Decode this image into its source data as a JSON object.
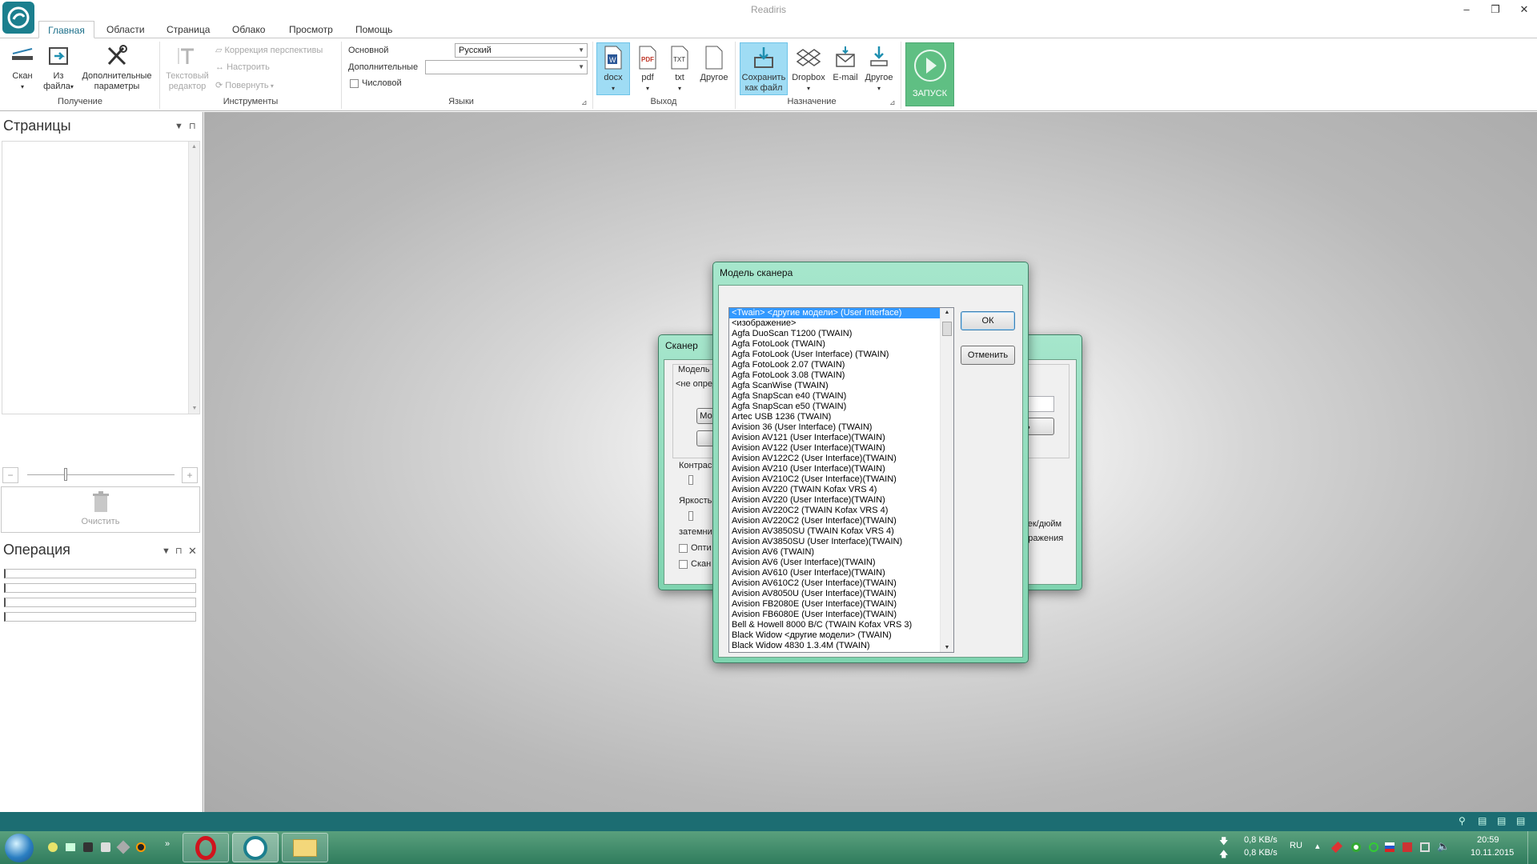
{
  "window": {
    "title": "Readiris",
    "minimize": "–",
    "restore": "❐",
    "close": "✕"
  },
  "tabs": [
    "Главная",
    "Области",
    "Страница",
    "Облако",
    "Просмотр",
    "Помощь"
  ],
  "ribbon": {
    "acquire": {
      "scan": "Скан",
      "from_file_1": "Из",
      "from_file_2": "файла",
      "advanced_1": "Дополнительные",
      "advanced_2": "параметры",
      "group": "Получение"
    },
    "tools": {
      "text_editor_1": "Текстовый",
      "text_editor_2": "редактор",
      "perspective": "Коррекция перспективы",
      "adjust": "Настроить",
      "rotate": "Повернуть",
      "group": "Инструменты"
    },
    "languages": {
      "main_label": "Основной",
      "main_value": "Русский",
      "extra_label": "Дополнительные",
      "extra_value": "",
      "numeric": "Числовой",
      "group": "Языки"
    },
    "output": {
      "docx": "docx",
      "pdf": "pdf",
      "txt": "txt",
      "other": "Другое",
      "group": "Выход"
    },
    "destination": {
      "save_1": "Сохранить",
      "save_2": "как файл",
      "dropbox": "Dropbox",
      "email": "E-mail",
      "other": "Другое",
      "group": "Назначение"
    },
    "launch": "ЗАПУСК"
  },
  "left": {
    "pages_title": "Страницы",
    "clear": "Очистить",
    "operations_title": "Операция"
  },
  "scanner_dialog": {
    "title": "Сканер",
    "model_label": "Модель с",
    "model_value": "<не опред",
    "model_btn": "Мо",
    "contrast": "Контрас",
    "brightness": "Яркость",
    "darken": "затемни",
    "opt1": "Опти",
    "opt2": "Скан",
    "right_btn": "ь",
    "resolution_tail": "а",
    "dpi_tail": "чек/дюйм",
    "image_tail": "бражения"
  },
  "model_dialog": {
    "title": "Модель сканера",
    "ok": "ОК",
    "cancel": "Отменить",
    "items": [
      "<Twain> <другие модели> (User Interface)",
      "<изображение>",
      "Agfa DuoScan T1200 (TWAIN)",
      "Agfa FotoLook (TWAIN)",
      "Agfa FotoLook (User Interface) (TWAIN)",
      "Agfa FotoLook 2.07 (TWAIN)",
      "Agfa FotoLook 3.08 (TWAIN)",
      "Agfa ScanWise (TWAIN)",
      "Agfa SnapScan e40 (TWAIN)",
      "Agfa SnapScan e50 (TWAIN)",
      "Artec USB 1236 (TWAIN)",
      "Avision 36 (User Interface) (TWAIN)",
      "Avision AV121 (User Interface)(TWAIN)",
      "Avision AV122 (User Interface)(TWAIN)",
      "Avision AV122C2 (User Interface)(TWAIN)",
      "Avision AV210 (User Interface)(TWAIN)",
      "Avision AV210C2 (User Interface)(TWAIN)",
      "Avision AV220 (TWAIN Kofax VRS 4)",
      "Avision AV220 (User Interface)(TWAIN)",
      "Avision AV220C2 (TWAIN Kofax VRS 4)",
      "Avision AV220C2 (User Interface)(TWAIN)",
      "Avision AV3850SU (TWAIN Kofax VRS 4)",
      "Avision AV3850SU (User Interface)(TWAIN)",
      "Avision AV6 (TWAIN)",
      "Avision AV6 (User Interface)(TWAIN)",
      "Avision AV610 (User Interface)(TWAIN)",
      "Avision AV610C2 (User Interface)(TWAIN)",
      "Avision AV8050U (User Interface)(TWAIN)",
      "Avision FB2080E (User Interface)(TWAIN)",
      "Avision FB6080E (User Interface)(TWAIN)",
      "Bell & Howell 8000 B/C (TWAIN Kofax VRS 3)",
      "Black Widow <другие модели> (TWAIN)",
      "Black Widow 4830 1.3.4M (TWAIN)"
    ]
  },
  "taskbar": {
    "net_down": "0,8 KB/s",
    "net_up": "0,8 KB/s",
    "lang": "RU",
    "time": "20:59",
    "date": "10.11.2015"
  },
  "colors": {
    "accent": "#1b7f8e",
    "launch": "#5fbf83",
    "dialog_frame": "#7fd4b0",
    "selection": "#3399ff"
  }
}
